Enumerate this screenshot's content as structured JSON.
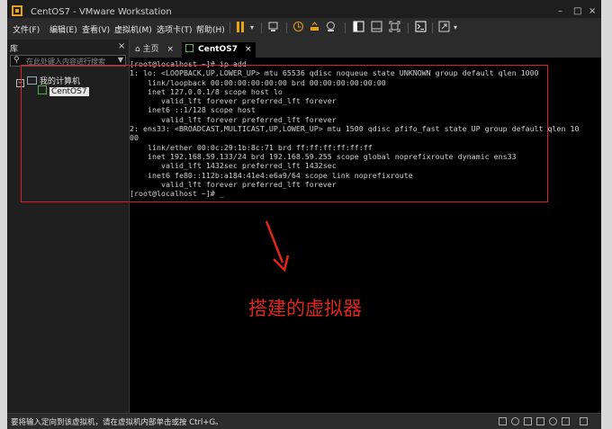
{
  "window": {
    "title": "CentOS7 - VMware Workstation",
    "controls": {
      "min": "–",
      "max": "□",
      "close": "×"
    }
  },
  "menubar": {
    "items": [
      "文件(F)",
      "编辑(E)",
      "查看(V)",
      "虚拟机(M)",
      "选项卡(T)",
      "帮助(H)"
    ]
  },
  "library": {
    "header": "库",
    "close": "×",
    "search_placeholder": "在此处键入内容进行搜索",
    "tree": {
      "root": "我的计算机",
      "vm": "CentOS7"
    }
  },
  "tabs": [
    {
      "label": "主页",
      "close": "×"
    },
    {
      "label": "CentOS7",
      "close": "×"
    }
  ],
  "console": {
    "lines": [
      "[root@localhost ~]# ip add",
      "1: lo: <LOOPBACK,UP,LOWER_UP> mtu 65536 qdisc noqueue state UNKNOWN group default qlen 1000",
      "    link/loopback 00:00:00:00:00:00 brd 00:00:00:00:00:00",
      "    inet 127.0.0.1/8 scope host lo",
      "       valid_lft forever preferred_lft forever",
      "    inet6 ::1/128 scope host",
      "       valid_lft forever preferred_lft forever",
      "2: ens33: <BROADCAST,MULTICAST,UP,LOWER_UP> mtu 1500 qdisc pfifo_fast state UP group default qlen 10",
      "00",
      "    link/ether 00:0c:29:1b:8c:71 brd ff:ff:ff:ff:ff:ff",
      "    inet 192.168.59.133/24 brd 192.168.59.255 scope global noprefixroute dynamic ens33",
      "       valid_lft 1432sec preferred_lft 1432sec",
      "    inet6 fe80::112b:a184:41e4:e6a9/64 scope link noprefixroute",
      "       valid_lft forever preferred_lft forever",
      "[root@localhost ~]# _"
    ]
  },
  "annotation": {
    "text": "搭建的虚拟器",
    "color": "#e0251b"
  },
  "statusbar": {
    "message": "要将输入定向到该虚拟机，请在虚拟机内部单击或按 Ctrl+G。"
  },
  "colors": {
    "accent": "#e8a21a",
    "highlight_box": "#e02020",
    "console_bg": "#000000",
    "console_text": "#d0d0d0"
  }
}
